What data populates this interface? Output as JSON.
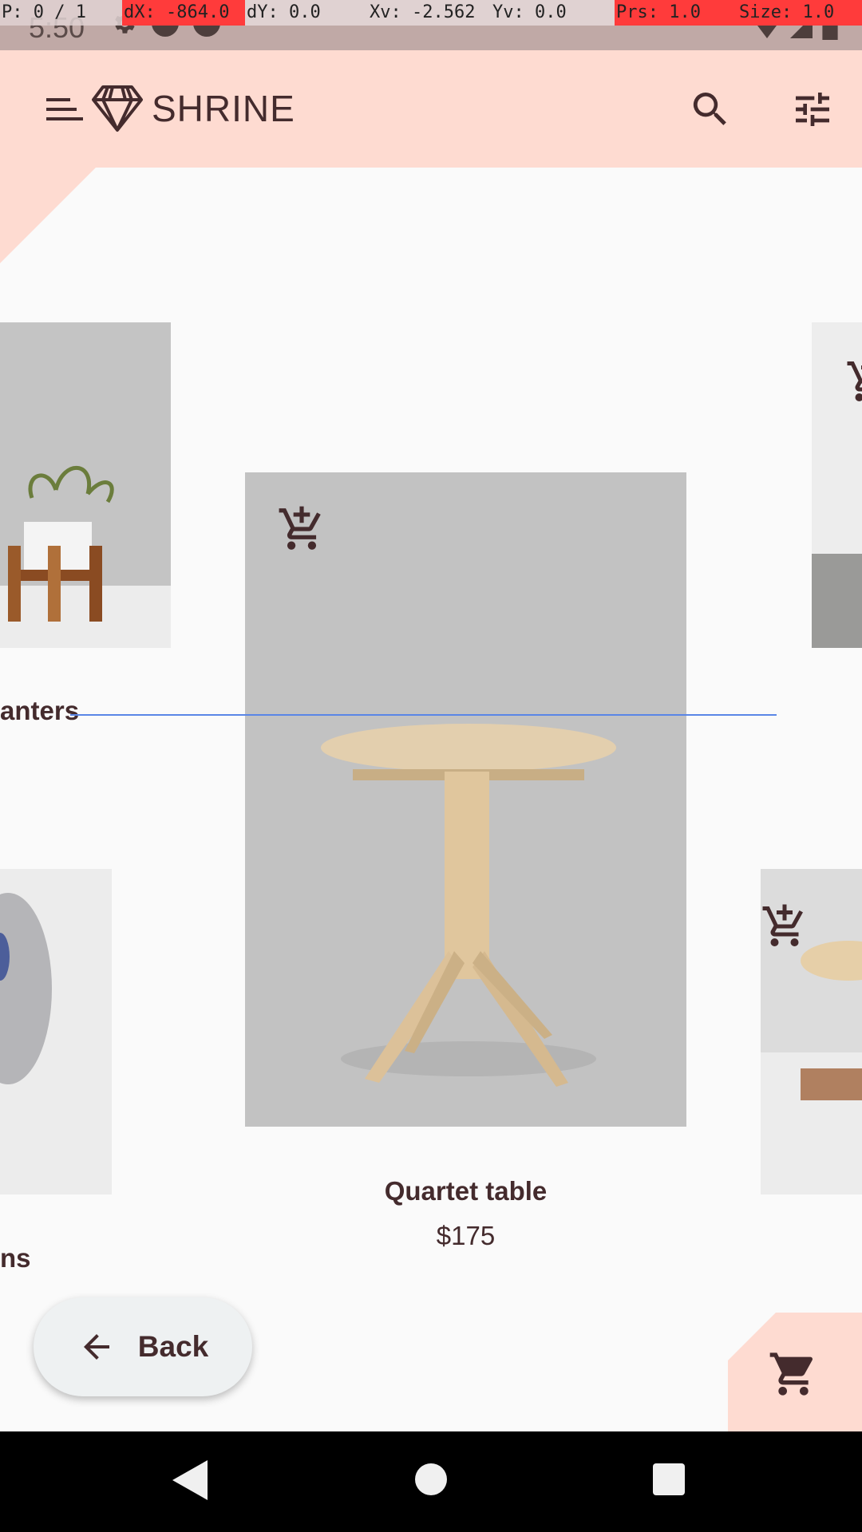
{
  "debug": {
    "pointer": "P: 0 / 1",
    "dx": "dX: -864.0",
    "dy": "dY: 0.0",
    "xv": "Xv: -2.562",
    "yv": "Yv: 0.0",
    "prs": "Prs: 1.0",
    "size": "Size: 1.0"
  },
  "status_bar": {
    "time": "5:50"
  },
  "app_bar": {
    "title": "SHRINE"
  },
  "products": {
    "left_top": {
      "name": "anters"
    },
    "center": {
      "name": "Quartet table",
      "price": "$175"
    },
    "left_bottom": {
      "name": "ns"
    }
  },
  "back_button": {
    "label": "Back"
  },
  "colors": {
    "primary": "#fedbd1",
    "on_primary": "#442b2d",
    "background": "#fafafa",
    "debug_red": "#ff3b3b",
    "debug_gray": "#e0d2d2"
  }
}
